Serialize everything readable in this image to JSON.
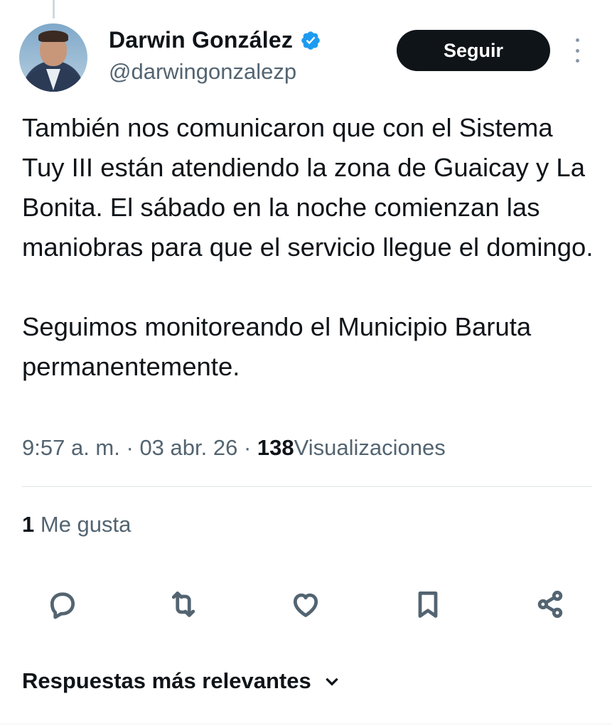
{
  "author": {
    "name": "Darwin González",
    "handle": "@darwingonzalezp",
    "verified": true
  },
  "follow_button_label": "Seguir",
  "tweet": {
    "paragraphs": [
      "También nos comunicaron que con el Sistema Tuy III están atendiendo la zona de Guaicay y La Bonita. El sábado en la noche comienzan las maniobras para que el servicio llegue el domingo.",
      "Seguimos monitoreando el Municipio Baruta permanentemente."
    ],
    "time": "9:57 a. m.",
    "date": "03 abr. 26",
    "views_count": "138",
    "views_label": "Visualizaciones",
    "separator": "·"
  },
  "likes": {
    "count": "1",
    "label": "Me gusta"
  },
  "actions": [
    "reply-icon",
    "retweet-icon",
    "like-icon",
    "bookmark-icon",
    "share-icon"
  ],
  "replies_sort_label": "Respuestas más relevantes",
  "colors": {
    "text": "#0f1419",
    "secondary": "#536471",
    "verified_blue": "#1d9bf0",
    "button_bg": "#0f1419"
  }
}
